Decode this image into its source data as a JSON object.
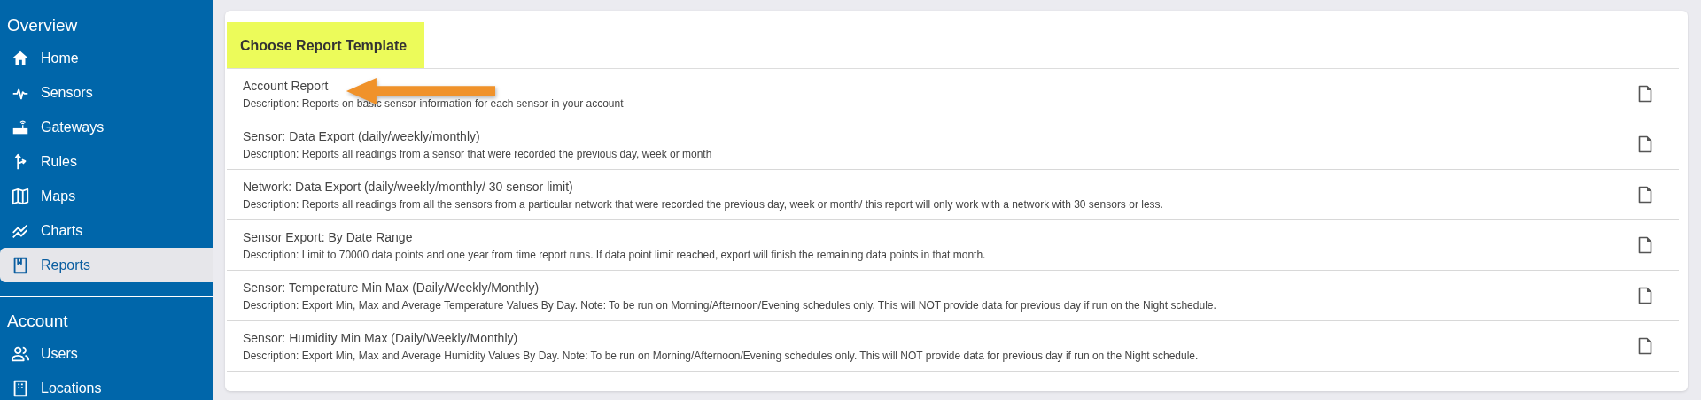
{
  "sidebar": {
    "sections": [
      {
        "title": "Overview",
        "items": [
          {
            "label": "Home",
            "selected": false
          },
          {
            "label": "Sensors",
            "selected": false
          },
          {
            "label": "Gateways",
            "selected": false
          },
          {
            "label": "Rules",
            "selected": false
          },
          {
            "label": "Maps",
            "selected": false
          },
          {
            "label": "Charts",
            "selected": false
          },
          {
            "label": "Reports",
            "selected": true
          }
        ]
      },
      {
        "title": "Account",
        "items": [
          {
            "label": "Users",
            "selected": false
          },
          {
            "label": "Locations",
            "selected": false
          }
        ]
      }
    ]
  },
  "panel": {
    "title": "Choose Report Template",
    "templates": [
      {
        "name": "Account Report",
        "description": "Description: Reports on basic sensor information for each sensor in your account"
      },
      {
        "name": "Sensor: Data Export (daily/weekly/monthly)",
        "description": "Description: Reports all readings from a sensor that were recorded the previous day, week or month"
      },
      {
        "name": "Network: Data Export (daily/weekly/monthly/ 30 sensor limit)",
        "description": "Description: Reports all readings from all the sensors from a particular network that were recorded the previous day, week or month/ this report will only work with a network with 30 sensors or less."
      },
      {
        "name": "Sensor Export: By Date Range",
        "description": "Description: Limit to 70000 data points and one year from time report runs. If data point limit reached, export will finish the remaining data points in that month."
      },
      {
        "name": "Sensor: Temperature Min Max (Daily/Weekly/Monthly)",
        "description": "Description: Export Min, Max and Average Temperature Values By Day. Note: To be run on Morning/Afternoon/Evening schedules only. This will NOT provide data for previous day if run on the Night schedule."
      },
      {
        "name": "Sensor: Humidity Min Max (Daily/Weekly/Monthly)",
        "description": "Description: Export Min, Max and Average Humidity Values By Day. Note: To be run on Morning/Afternoon/Evening schedules only. This will NOT provide data for previous day if run on the Night schedule."
      }
    ]
  }
}
